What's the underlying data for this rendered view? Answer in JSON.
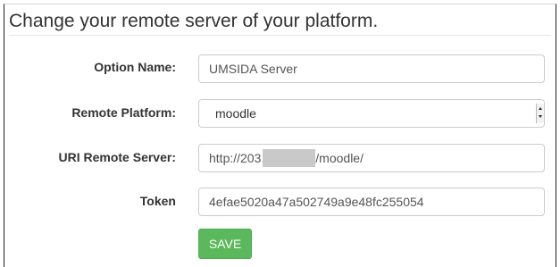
{
  "form": {
    "title": "Change your remote server of your platform.",
    "option_name": {
      "label": "Option Name:",
      "value": "UMSIDA Server"
    },
    "remote_platform": {
      "label": "Remote Platform:",
      "selected": "moodle"
    },
    "uri_remote_server": {
      "label": "URI Remote Server:",
      "value_prefix": "http://203.",
      "value_suffix": "/moodle/"
    },
    "token": {
      "label": "Token",
      "value": "4efae5020a47a502749a9e48fc255054"
    },
    "save_label": "SAVE"
  },
  "colors": {
    "save_button": "#5cb85c",
    "save_button_text": "#ffffff",
    "field_border": "#cccccc",
    "label_text": "#333333"
  }
}
